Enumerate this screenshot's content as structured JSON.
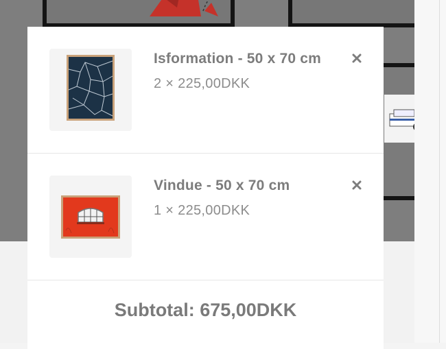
{
  "cart": {
    "items": [
      {
        "name": "Isformation - 50 x 70 cm",
        "quantity": "2",
        "times_symbol": "×",
        "price": "225,00DKK",
        "thumbnail_icon": "cracked-ice-poster-image",
        "remove_icon": "remove-x-icon"
      },
      {
        "name": "Vindue - 50 x 70 cm",
        "quantity": "1",
        "times_symbol": "×",
        "price": "225,00DKK",
        "thumbnail_icon": "red-wall-window-poster-image",
        "remove_icon": "remove-x-icon"
      }
    ],
    "subtotal_label": "Subtotal:",
    "subtotal_value": "675,00DKK"
  },
  "colors": {
    "overlay_gray": "#7e7e7e",
    "text_gray": "#7c7c7c",
    "accent_red": "#e2391d",
    "poster_blue": "#1c3246"
  }
}
